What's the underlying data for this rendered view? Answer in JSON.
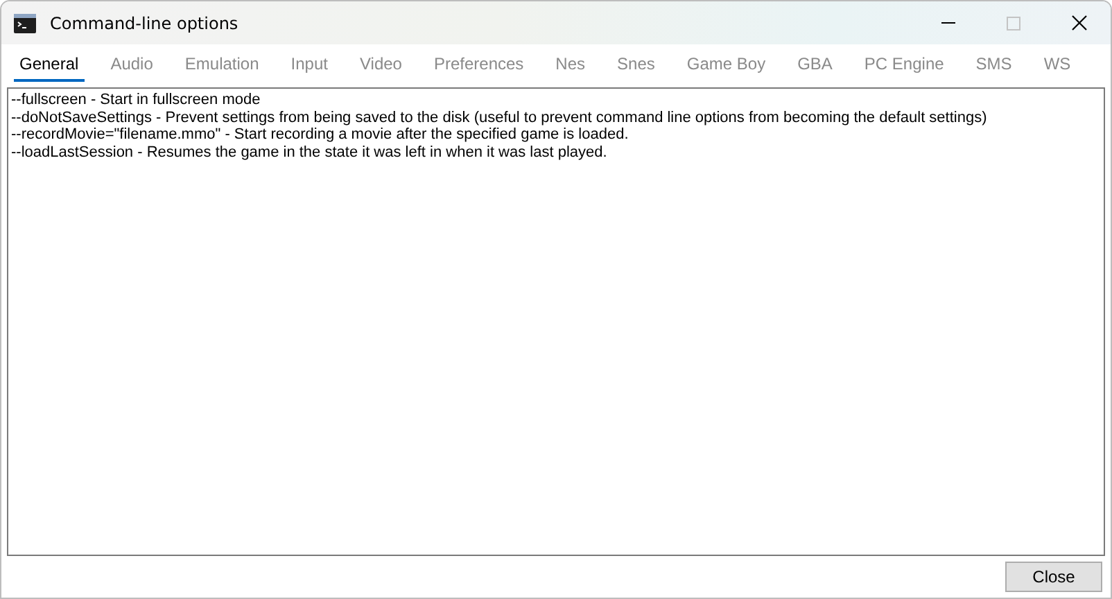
{
  "window": {
    "title": "Command-line options"
  },
  "tabs": [
    {
      "label": "General",
      "selected": true
    },
    {
      "label": "Audio",
      "selected": false
    },
    {
      "label": "Emulation",
      "selected": false
    },
    {
      "label": "Input",
      "selected": false
    },
    {
      "label": "Video",
      "selected": false
    },
    {
      "label": "Preferences",
      "selected": false
    },
    {
      "label": "Nes",
      "selected": false
    },
    {
      "label": "Snes",
      "selected": false
    },
    {
      "label": "Game Boy",
      "selected": false
    },
    {
      "label": "GBA",
      "selected": false
    },
    {
      "label": "PC Engine",
      "selected": false
    },
    {
      "label": "SMS",
      "selected": false
    },
    {
      "label": "WS",
      "selected": false
    }
  ],
  "options_text": [
    "--fullscreen - Start in fullscreen mode",
    "--doNotSaveSettings - Prevent settings from being saved to the disk (useful to prevent command line options from becoming the default settings)",
    "--recordMovie=\"filename.mmo\" - Start recording a movie after the specified game is loaded.",
    "--loadLastSession - Resumes the game in the state it was left in when it was last played."
  ],
  "buttons": [
    "Close"
  ]
}
